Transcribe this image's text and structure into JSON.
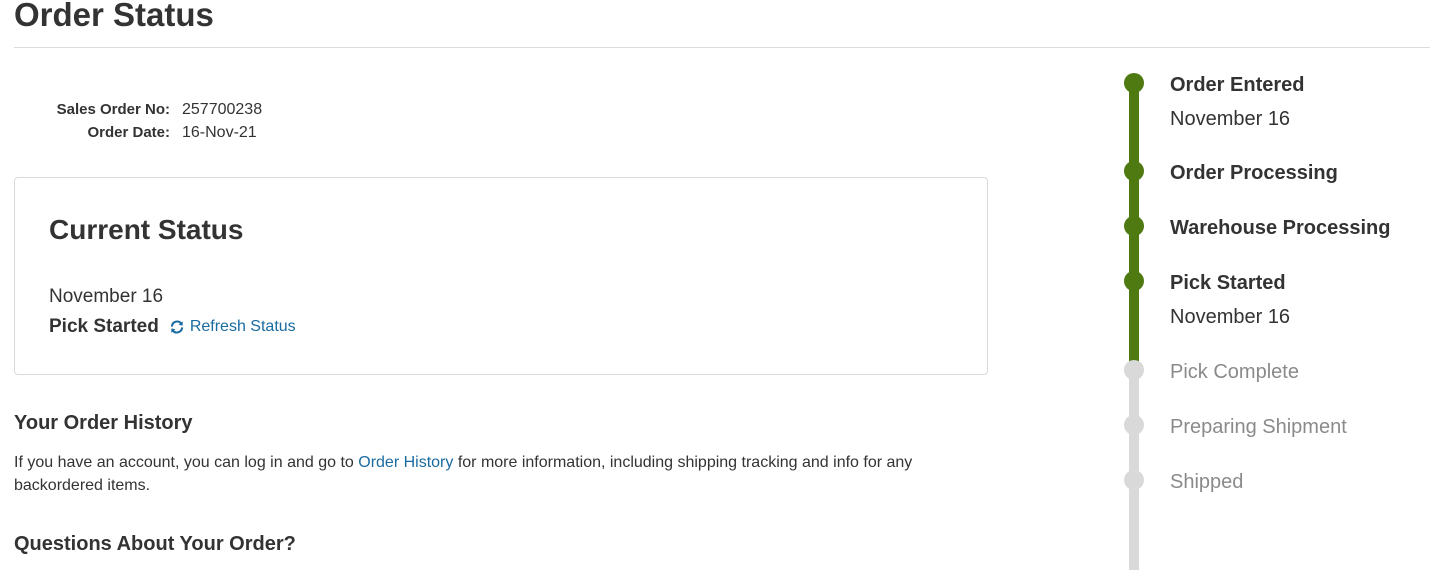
{
  "page": {
    "title": "Order Status"
  },
  "order": {
    "sales_order_label": "Sales Order No:",
    "sales_order_value": "257700238",
    "order_date_label": "Order Date:",
    "order_date_value": "16-Nov-21"
  },
  "current_status": {
    "title": "Current Status",
    "date": "November 16",
    "status": "Pick Started",
    "refresh_label": "Refresh Status",
    "refresh_icon": "refresh-icon"
  },
  "history": {
    "heading": "Your Order History",
    "text_before": "If you have an account, you can log in and go to ",
    "link_label": "Order History",
    "text_after": " for more information, including shipping tracking and info for any backordered items."
  },
  "questions": {
    "heading": "Questions About Your Order?"
  },
  "timeline": {
    "colors": {
      "done": "#4f7a12",
      "pending": "#d9d9d9"
    },
    "steps": [
      {
        "label": "Order Entered",
        "date": "November 16",
        "done": true
      },
      {
        "label": "Order Processing",
        "date": "",
        "done": true
      },
      {
        "label": "Warehouse Processing",
        "date": "",
        "done": true
      },
      {
        "label": "Pick Started",
        "date": "November 16",
        "done": true
      },
      {
        "label": "Pick Complete",
        "date": "",
        "done": false
      },
      {
        "label": "Preparing Shipment",
        "date": "",
        "done": false
      },
      {
        "label": "Shipped",
        "date": "",
        "done": false
      }
    ]
  }
}
